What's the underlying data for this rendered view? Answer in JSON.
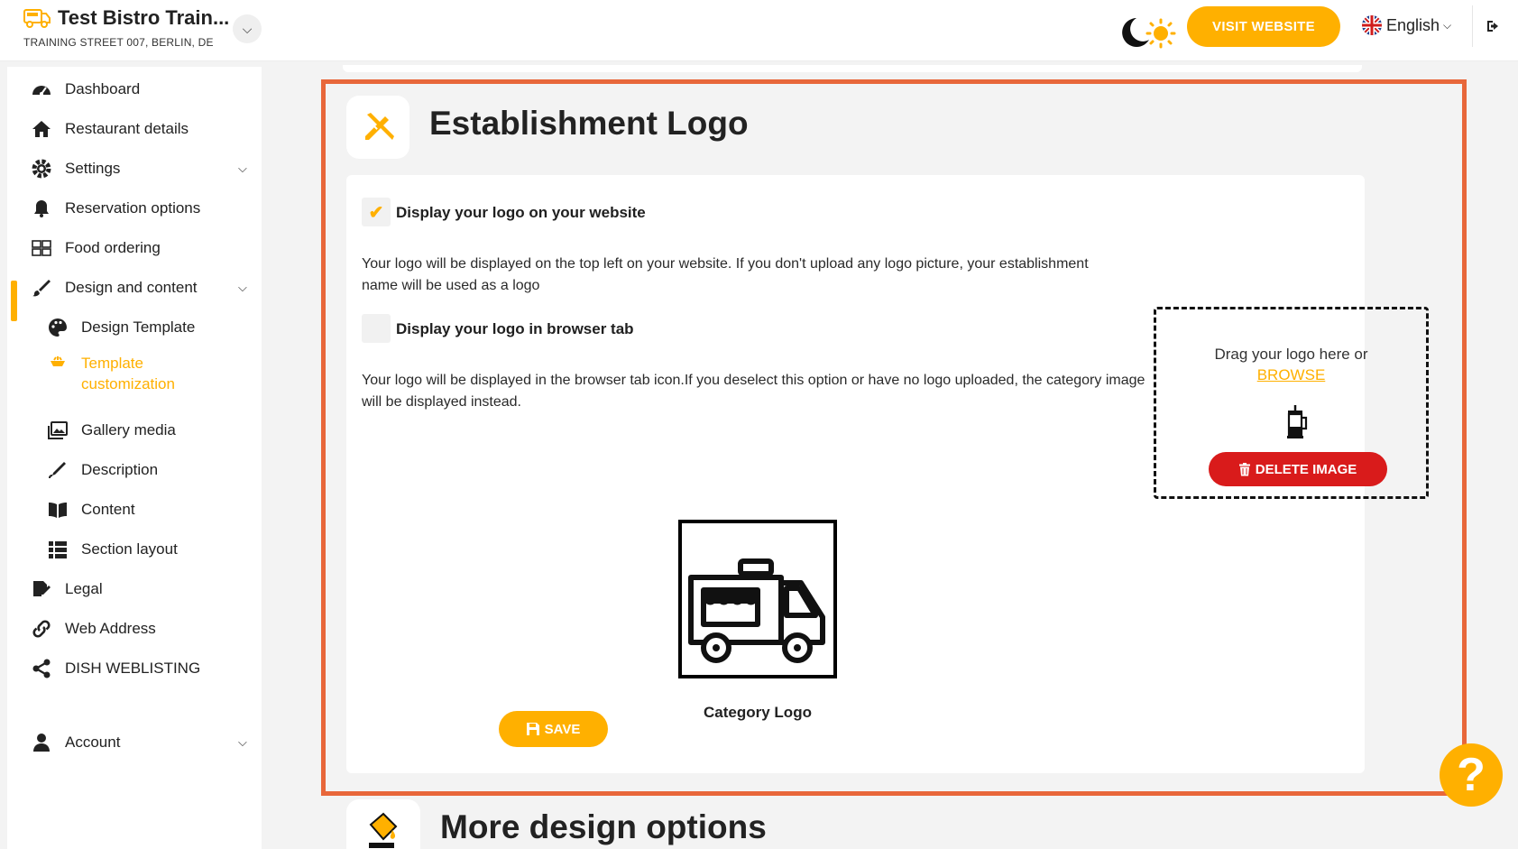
{
  "header": {
    "brand_name": "Test Bistro Train...",
    "brand_address": "TRAINING STREET 007, BERLIN, DE",
    "visit_label": "VISIT WEBSITE",
    "language": "English"
  },
  "sidebar": {
    "items": [
      {
        "label": "Dashboard",
        "icon": "dashboard-icon"
      },
      {
        "label": "Restaurant details",
        "icon": "home-icon"
      },
      {
        "label": "Settings",
        "icon": "gear-icon"
      },
      {
        "label": "Reservation options",
        "icon": "bell-icon"
      },
      {
        "label": "Food ordering",
        "icon": "food-icon"
      },
      {
        "label": "Design and content",
        "icon": "brush-icon"
      },
      {
        "label": "Design Template",
        "icon": "palette-icon"
      },
      {
        "label": "Template customization",
        "icon": "magic-icon"
      },
      {
        "label": "Gallery media",
        "icon": "images-icon"
      },
      {
        "label": "Description",
        "icon": "pen-icon"
      },
      {
        "label": "Content",
        "icon": "book-icon"
      },
      {
        "label": "Section layout",
        "icon": "list-icon"
      },
      {
        "label": "Legal",
        "icon": "signature-icon"
      },
      {
        "label": "Web Address",
        "icon": "link-icon"
      },
      {
        "label": "DISH WEBLISTING",
        "icon": "share-icon"
      },
      {
        "label": "Account",
        "icon": "user-icon"
      }
    ]
  },
  "main": {
    "section_title": "Establishment Logo",
    "option1_label": "Display your logo on your website",
    "option1_desc": "Your logo will be displayed on the top left on your website. If you don't upload any logo picture, your establishment name will be used as a logo",
    "option2_label": "Display your logo in browser tab",
    "option2_desc": "Your logo will be displayed in the browser tab icon.If you deselect this option or have no logo uploaded, the category image will be displayed instead.",
    "dropzone_text": "Drag your logo here or",
    "browse_label": "BROWSE",
    "delete_label": "DELETE IMAGE",
    "category_caption": "Category Logo",
    "save_label": "SAVE",
    "next_section_title": "More design options",
    "help_label": "?"
  },
  "colors": {
    "accent": "#ffb000",
    "danger": "#d91b1b",
    "highlight": "#e8673a"
  }
}
